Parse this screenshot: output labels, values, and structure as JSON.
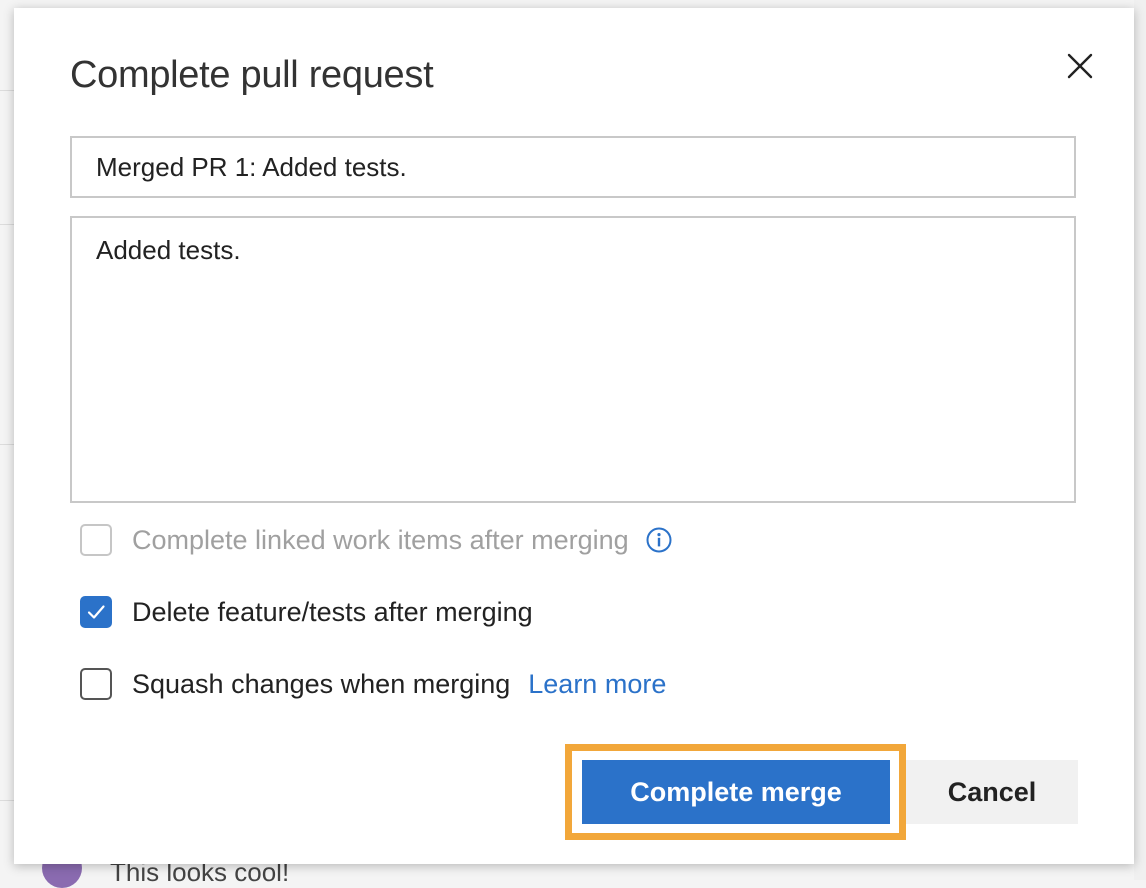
{
  "background": {
    "comment_text": "This looks cool!"
  },
  "dialog": {
    "title": "Complete pull request",
    "close_icon": "close-icon",
    "merge_title_value": "Merged PR 1: Added tests.",
    "merge_description_value": "Added tests.",
    "options": {
      "complete_work_items": {
        "label": "Complete linked work items after merging",
        "checked": false,
        "disabled": true,
        "info_icon": "info-icon"
      },
      "delete_branch": {
        "label": "Delete feature/tests after merging",
        "checked": true
      },
      "squash": {
        "label": "Squash changes when merging",
        "checked": false,
        "link_label": "Learn more"
      }
    },
    "buttons": {
      "complete_label": "Complete merge",
      "cancel_label": "Cancel"
    }
  },
  "colors": {
    "accent": "#2b72c9",
    "highlight": "#f2a73a"
  }
}
